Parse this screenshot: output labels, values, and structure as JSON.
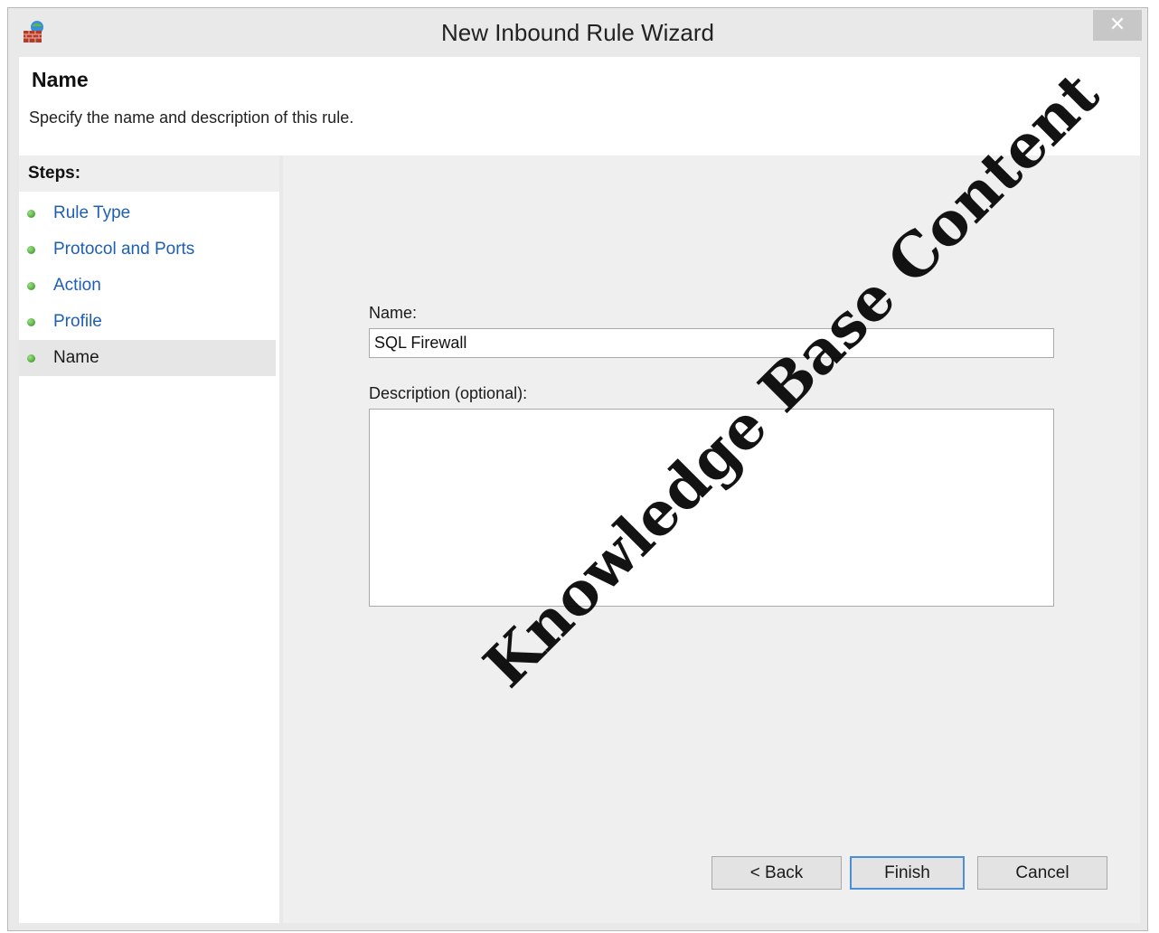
{
  "window": {
    "title": "New Inbound Rule Wizard",
    "close_glyph": "✕"
  },
  "header": {
    "title": "Name",
    "subtitle": "Specify the name and description of this rule."
  },
  "steps": {
    "title": "Steps:",
    "items": [
      {
        "label": "Rule Type",
        "state": "completed"
      },
      {
        "label": "Protocol and Ports",
        "state": "completed"
      },
      {
        "label": "Action",
        "state": "completed"
      },
      {
        "label": "Profile",
        "state": "completed"
      },
      {
        "label": "Name",
        "state": "current"
      }
    ]
  },
  "form": {
    "name_label": "Name:",
    "name_value": "SQL Firewall",
    "description_label": "Description (optional):",
    "description_value": ""
  },
  "buttons": {
    "back": "< Back",
    "finish": "Finish",
    "cancel": "Cancel"
  },
  "watermark": "Knowledge Base Content",
  "colors": {
    "link": "#1e5fb4",
    "step_dot": "#3a9a2a",
    "default_button_border": "#4a90d9"
  },
  "icons": {
    "app": "firewall-icon",
    "step": "green-dot-icon",
    "close": "close-icon"
  }
}
